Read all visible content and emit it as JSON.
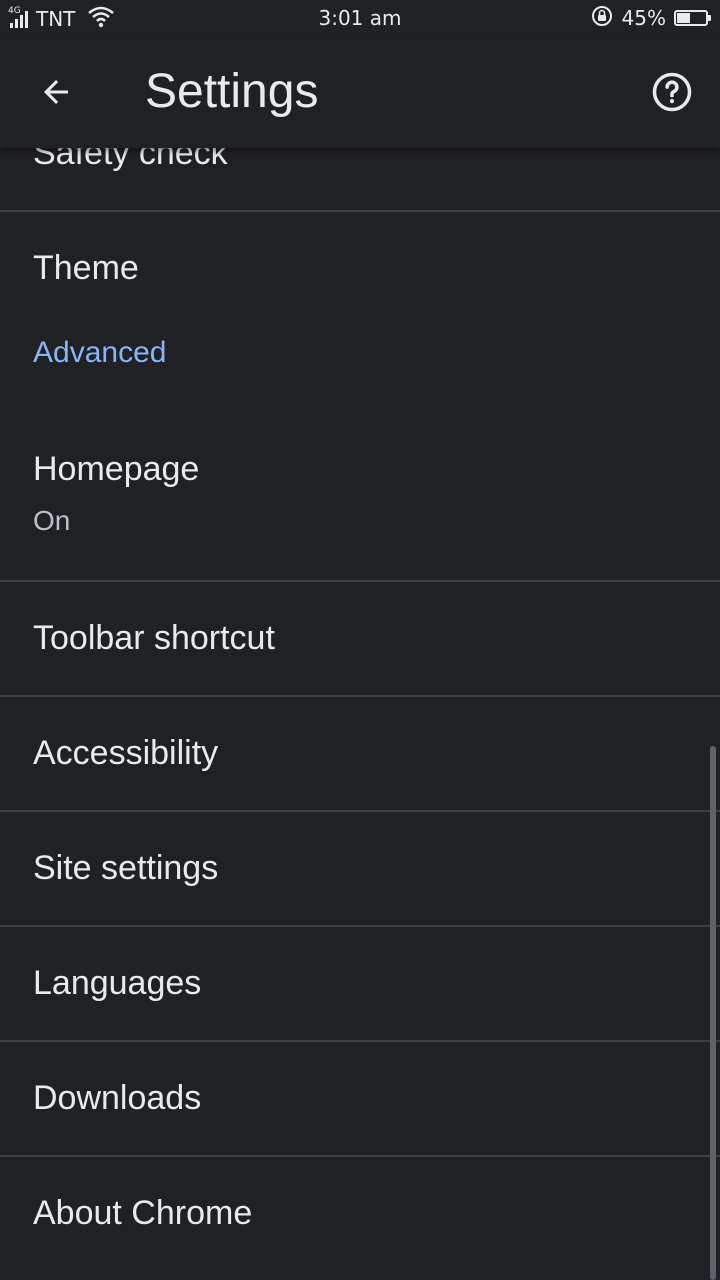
{
  "status_bar": {
    "network_type": "4G",
    "carrier": "TNT",
    "time": "3:01 am",
    "battery_percent_label": "45%",
    "battery_level": 0.45
  },
  "app_bar": {
    "title": "Settings",
    "back_icon": "arrow-back-icon",
    "help_icon": "help-circle-icon"
  },
  "settings": {
    "items": [
      {
        "label": "Safety check"
      },
      {
        "label": "Theme"
      },
      {
        "section_header": "Advanced"
      },
      {
        "label": "Homepage",
        "summary": "On"
      },
      {
        "label": "Toolbar shortcut"
      },
      {
        "label": "Accessibility"
      },
      {
        "label": "Site settings"
      },
      {
        "label": "Languages"
      },
      {
        "label": "Downloads"
      },
      {
        "label": "About Chrome"
      }
    ]
  },
  "colors": {
    "background": "#202124",
    "text": "#e8eaed",
    "section_accent": "#8ab4f8",
    "divider": "#3c4043"
  }
}
